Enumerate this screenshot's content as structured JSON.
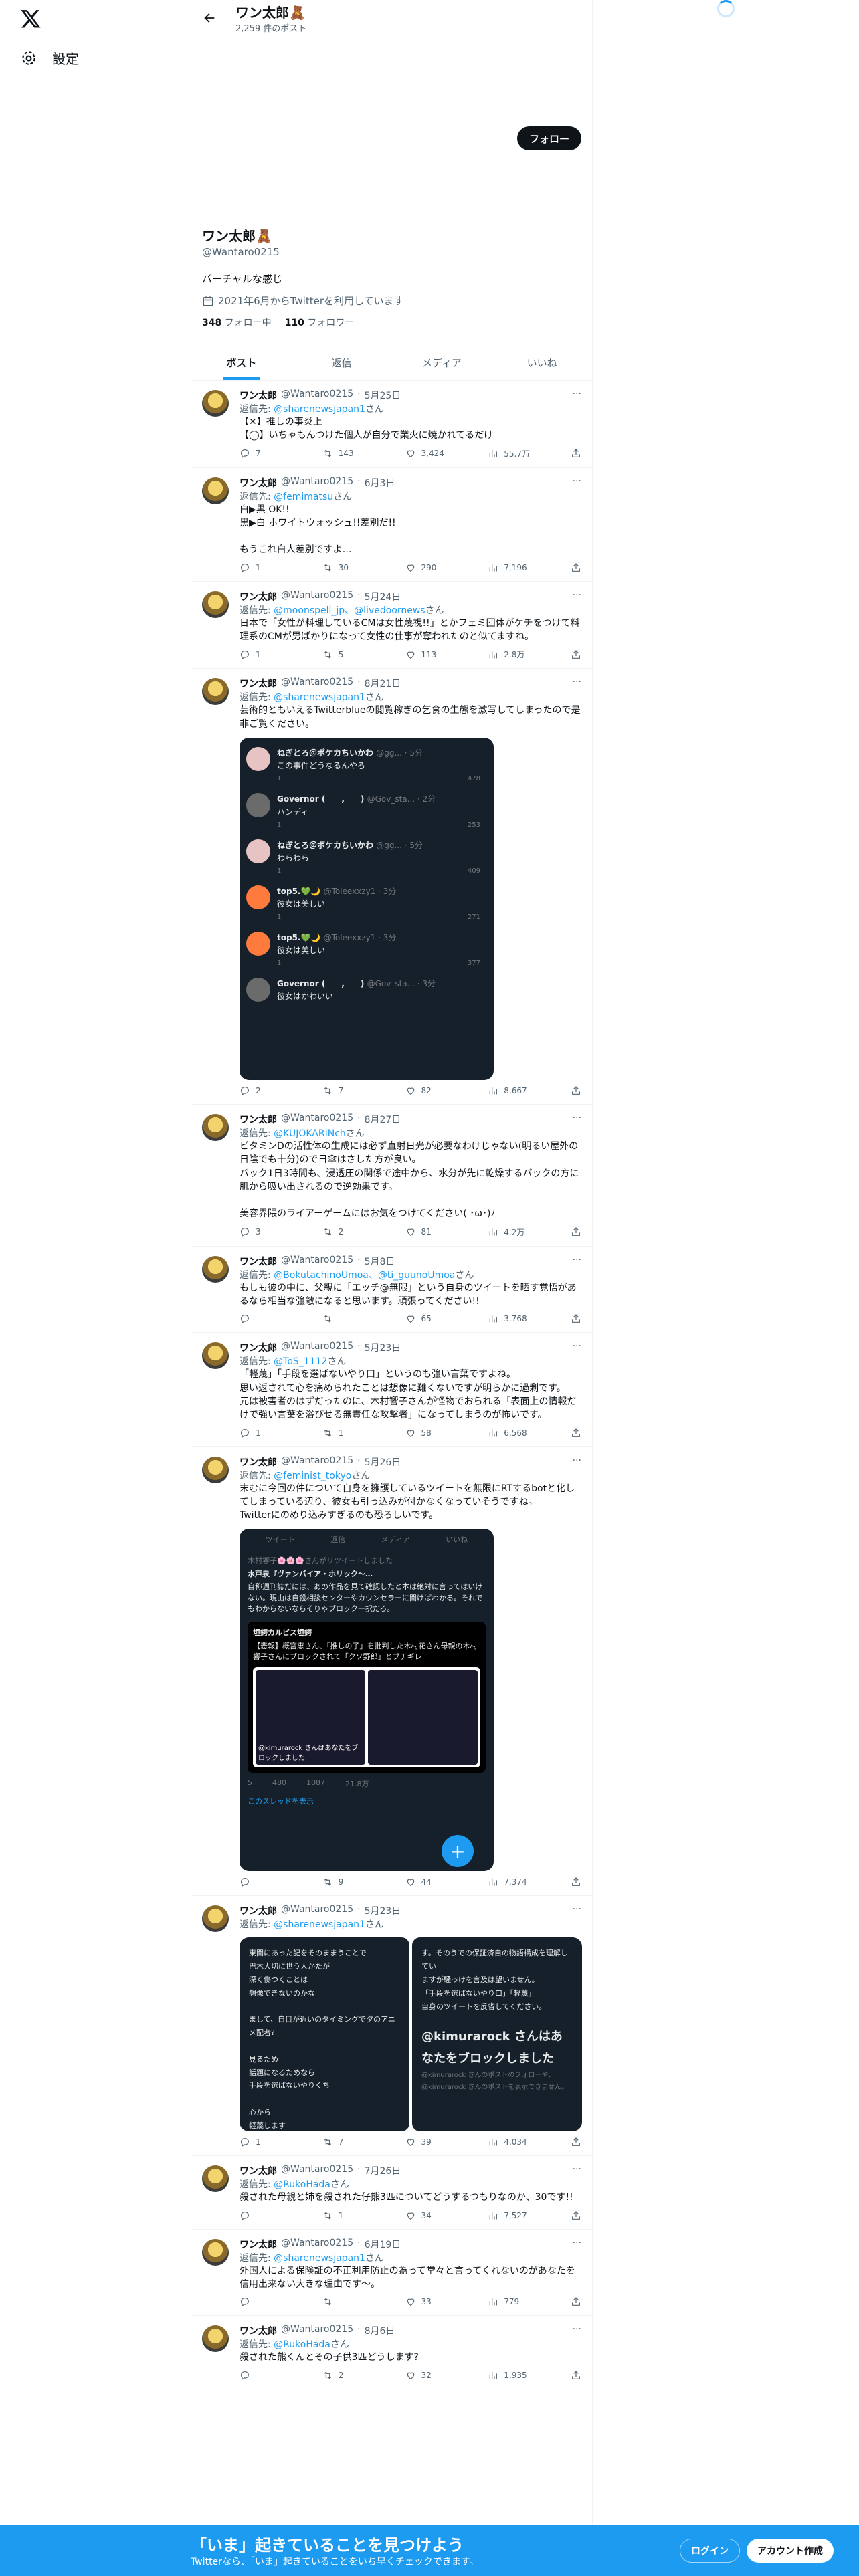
{
  "nav": {
    "settings_label": "設定"
  },
  "header": {
    "name": "ワン太郎🧸",
    "post_count": "2,259 件のポスト"
  },
  "profile": {
    "follow_label": "フォロー",
    "name": "ワン太郎🧸",
    "handle": "@Wantaro0215",
    "bio": "バーチャルな感じ",
    "joined": "2021年6月からTwitterを利用しています",
    "following_num": "348",
    "following_label": "フォロー中",
    "followers_num": "110",
    "followers_label": "フォロワー"
  },
  "tabs": [
    "ポスト",
    "返信",
    "メディア",
    "いいね"
  ],
  "tweets": [
    {
      "name": "ワン太郎",
      "handle": "@Wantaro0215",
      "date": "5月25日",
      "reply_prefix": "返信先: ",
      "reply_to": "@sharenewsjapan1",
      "reply_suffix": "さん",
      "text": "【✕】推しの事炎上\n【◯】いちゃもんつけた個人が自分で業火に焼かれてるだけ",
      "replies": "7",
      "reposts": "143",
      "likes": "3,424",
      "views": "55.7万"
    },
    {
      "name": "ワン太郎",
      "handle": "@Wantaro0215",
      "date": "6月3日",
      "reply_prefix": "返信先: ",
      "reply_to": "@femimatsu",
      "reply_suffix": "さん",
      "text": "白▶黒 OK!!\n黒▶白 ホワイトウォッシュ!!差別だ!!\n\nもうこれ白人差別ですよ…",
      "replies": "1",
      "reposts": "30",
      "likes": "290",
      "views": "7,196"
    },
    {
      "name": "ワン太郎",
      "handle": "@Wantaro0215",
      "date": "5月24日",
      "reply_prefix": "返信先: ",
      "reply_to": "@moonspell_jp、@livedoornews",
      "reply_suffix": "さん",
      "text": "日本で「女性が料理しているCMは女性蔑視!!」とかフェミ団体がケチをつけて料理系のCMが男ばかりになって女性の仕事が奪われたのと似てますね。",
      "replies": "1",
      "reposts": "5",
      "likes": "113",
      "views": "2.8万"
    },
    {
      "name": "ワン太郎",
      "handle": "@Wantaro0215",
      "date": "8月21日",
      "reply_prefix": "返信先: ",
      "reply_to": "@sharenewsjapan1",
      "reply_suffix": "さん",
      "text": "芸術的ともいえるTwitterblueの閲覧稼ぎの乞食の生態を激写してしまったので是非ご覧ください。",
      "replies": "2",
      "reposts": "7",
      "likes": "82",
      "views": "8,667"
    },
    {
      "name": "ワン太郎",
      "handle": "@Wantaro0215",
      "date": "8月27日",
      "reply_prefix": "返信先: ",
      "reply_to": "@KUJOKARINch",
      "reply_suffix": "さん",
      "text": "ビタミンDの活性体の生成には必ず直射日光が必要なわけじゃない(明るい屋外の日陰でも十分)ので日傘はさした方が良い。\nバック1日3時間も、浸透圧の関係で途中から、水分が先に乾燥するパックの方に肌から吸い出されるので逆効果です。\n\n美容界隈のライアーゲームにはお気をつけてください( ･ω･)ﾉ",
      "replies": "3",
      "reposts": "2",
      "likes": "81",
      "views": "4.2万"
    },
    {
      "name": "ワン太郎",
      "handle": "@Wantaro0215",
      "date": "5月8日",
      "reply_prefix": "返信先: ",
      "reply_to": "@BokutachinoUmoa、@ti_guunoUmoa",
      "reply_suffix": "さん",
      "text": "もしも彼の中に、父親に「エッチ@無限」という自身のツイートを晒す覚悟があるなら相当な強敵になると思います。頑張ってください!!",
      "replies": "",
      "reposts": "",
      "likes": "65",
      "views": "3,768"
    },
    {
      "name": "ワン太郎",
      "handle": "@Wantaro0215",
      "date": "5月23日",
      "reply_prefix": "返信先: ",
      "reply_to": "@ToS_1112",
      "reply_suffix": "さん",
      "text": "「軽蔑」「手段を選ばないやり口」というのも強い言葉ですよね。\n思い返されて心を痛められたことは想像に難くないですが明らかに過剰です。\n元は被害者のはずだったのに、木村響子さんが怪物でおられる「表面上の情報だけで強い言葉を浴びせる無責任な攻撃者」になってしまうのが怖いです。",
      "replies": "1",
      "reposts": "1",
      "likes": "58",
      "views": "6,568"
    },
    {
      "name": "ワン太郎",
      "handle": "@Wantaro0215",
      "date": "5月26日",
      "reply_prefix": "返信先: ",
      "reply_to": "@feminist_tokyo",
      "reply_suffix": "さん",
      "text": "末むに今回の件について自身を擁護しているツイートを無限にRTするbotと化してしまっている辺り、彼女も引っ込みが付かなくなっていそうですね。\nTwitterにのめり込みすぎるのも恐ろしいです。",
      "replies": "",
      "reposts": "9",
      "likes": "44",
      "views": "7,374"
    },
    {
      "name": "ワン太郎",
      "handle": "@Wantaro0215",
      "date": "5月23日",
      "reply_prefix": "返信先: ",
      "reply_to": "@sharenewsjapan1",
      "reply_suffix": "さん",
      "text": "",
      "replies": "1",
      "reposts": "7",
      "likes": "39",
      "views": "4,034"
    },
    {
      "name": "ワン太郎",
      "handle": "@Wantaro0215",
      "date": "7月26日",
      "reply_prefix": "返信先: ",
      "reply_to": "@RukoHada",
      "reply_suffix": "さん",
      "text": "殺された母親と姉を殺された仔熊3匹についてどうするつもりなのか、30です!!",
      "replies": "",
      "reposts": "1",
      "likes": "34",
      "views": "7,527"
    },
    {
      "name": "ワン太郎",
      "handle": "@Wantaro0215",
      "date": "6月19日",
      "reply_prefix": "返信先: ",
      "reply_to": "@sharenewsjapan1",
      "reply_suffix": "さん",
      "text": "外国人による保険証の不正利用防止の為って堂々と言ってくれないのがあなたを信用出来ない大きな理由です～。",
      "replies": "",
      "reposts": "",
      "likes": "33",
      "views": "779"
    },
    {
      "name": "ワン太郎",
      "handle": "@Wantaro0215",
      "date": "8月6日",
      "reply_prefix": "返信先: ",
      "reply_to": "@RukoHada",
      "reply_suffix": "さん",
      "text": "殺された熊くんとその子供3匹どうします?",
      "replies": "",
      "reposts": "2",
      "likes": "32",
      "views": "1,935"
    }
  ],
  "media1": {
    "rows": [
      {
        "name": "ねぎとろ＠ポケカちいかわ",
        "meta": "@gg... · 5分",
        "text": "この事件どうなるんやろ",
        "stats": [
          "1",
          "",
          "",
          "478"
        ]
      },
      {
        "name": "Governor (　　,　　)",
        "meta": "@Gov_sta... · 2分",
        "text": "ハンディ",
        "stats": [
          "1",
          "",
          "",
          "253"
        ]
      },
      {
        "name": "ねぎとろ＠ポケカちいかわ",
        "meta": "@gg... · 5分",
        "text": "わらわら",
        "stats": [
          "1",
          "",
          "",
          "409"
        ]
      },
      {
        "name": "top5.💚🌙",
        "meta": "@Toleexxzy1 · 3分",
        "text": "彼女は美しい",
        "stats": [
          "1",
          "",
          "",
          "271"
        ]
      },
      {
        "name": "top5.💚🌙",
        "meta": "@Toleexxzy1 · 3分",
        "text": "彼女は美しい",
        "stats": [
          "1",
          "",
          "",
          "377"
        ]
      },
      {
        "name": "Governor (　　,　　)",
        "meta": "@Gov_sta... · 3分",
        "text": "彼女はかわいい",
        "stats": [
          "",
          "",
          "",
          ""
        ]
      }
    ]
  },
  "media2": {
    "tabs": [
      "ツイート",
      "返信",
      "メディア",
      "いいね"
    ],
    "rt_line": "木村響子🌸🌸🌸さんがリツイートしました",
    "author": "水戸泉『ヴァンパイア・ホリック～…",
    "body": "自称週刊誌だには、あの作品を見て確認したと本は絶対に言ってはいけない。現由は自殺相談センターやカウンセラーに聞けばわかる。それでもわからないならそりゃブロック一択だろ。",
    "quote_name": "垣鍔カルピス垣鍔",
    "quote_text": "【悲報】概宮恵さん、「推しの子」を批判した木村花さん母親の木村響子さんにブロックされて「クソ野郎」とブチギレ",
    "overlay": "@kimurarock さんはあなたをブロックしました",
    "stats": [
      "5",
      "480",
      "1087",
      "21.8万"
    ],
    "thread_link": "このスレッドを表示"
  },
  "media3": {
    "left": "東聞にあった記をそのままうことで\n巴木大切に世う人かたが\n深く傷つくことは\n想像できないのかな\n\nまして、自目が近いのタイミングで夕のアニメ配者?\n\n見るため\n話題になるためなら\n手段を選ばないやりくち\n\n心から\n軽蔑します\n\nボのファンの方には",
    "right_top": "す。そのうでの保証済自の物語構成を理解してい\nますが騒っけを言及は望いません。\n「手段を選ばないやり口」「軽蔑」\n自身のツイートを反省してください。",
    "block_text": "@kimurarock さんはあなたをブロックしました",
    "block_sub": "@kimurarock さんのポストのフォローや、\n@kimurarock さんのポストを表示できません。"
  },
  "bottombar": {
    "title": "「いま」起きていることを見つけよう",
    "subtitle": "Twitterなら、「いま」起きていることをいち早くチェックできます。",
    "login": "ログイン",
    "signup": "アカウント作成"
  }
}
